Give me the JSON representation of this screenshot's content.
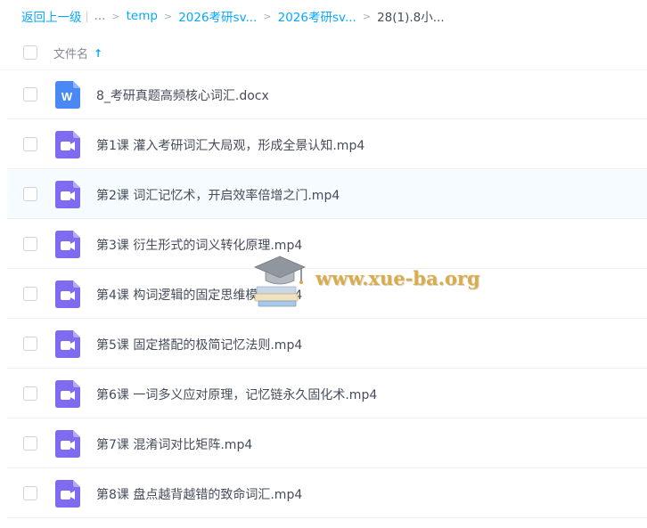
{
  "breadcrumb": {
    "back": "返回上一级",
    "ellipsis": "...",
    "items": [
      "temp",
      "2026考研sv...",
      "2026考研sv...",
      "28(1).8小..."
    ]
  },
  "list_header": {
    "column_name": "文件名",
    "sort_icon": "arrow-up-icon"
  },
  "files": [
    {
      "name": "8_考研真题高频核心词汇.docx",
      "type": "word",
      "icon": "word-doc-icon"
    },
    {
      "name": "第1课 灌入考研词汇大局观，形成全景认知.mp4",
      "type": "video",
      "icon": "video-file-icon"
    },
    {
      "name": "第2课 词汇记忆术，开启效率倍增之门.mp4",
      "type": "video",
      "icon": "video-file-icon"
    },
    {
      "name": "第3课 衍生形式的词义转化原理.mp4",
      "type": "video",
      "icon": "video-file-icon"
    },
    {
      "name": "第4课 构词逻辑的固定思维模式.mp4",
      "type": "video",
      "icon": "video-file-icon"
    },
    {
      "name": "第5课 固定搭配的极简记忆法则.mp4",
      "type": "video",
      "icon": "video-file-icon"
    },
    {
      "name": "第6课 一词多义应对原理，记忆链永久固化术.mp4",
      "type": "video",
      "icon": "video-file-icon"
    },
    {
      "name": "第7课 混淆词对比矩阵.mp4",
      "type": "video",
      "icon": "video-file-icon"
    },
    {
      "name": "第8课 盘点越背越错的致命词汇.mp4",
      "type": "video",
      "icon": "video-file-icon"
    }
  ],
  "watermark": {
    "text": "www.xue-ba.org",
    "icon": "graduation-cap-icon"
  },
  "colors": {
    "accent": "#06a7ff",
    "word": "#4a88f5",
    "video": "#7f6bf0",
    "hover_row": "#f5fbff"
  }
}
